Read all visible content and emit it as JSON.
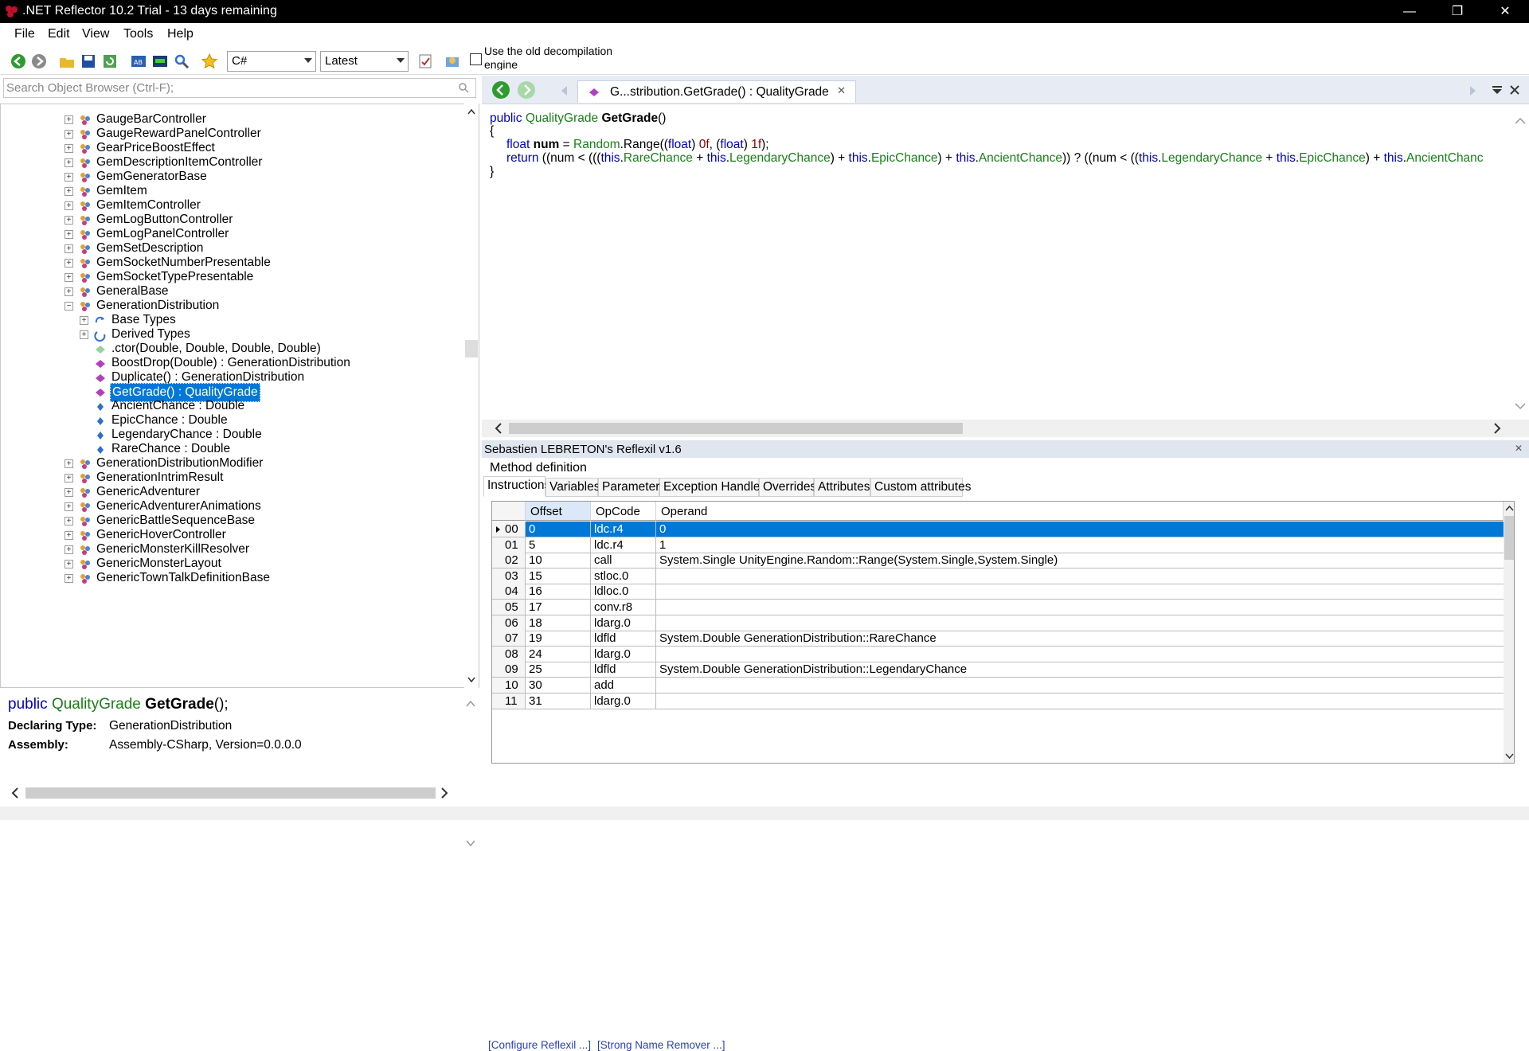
{
  "window": {
    "title": ".NET Reflector 10.2 Trial - 13 days remaining",
    "minimize": "—",
    "maximize": "❐",
    "close": "✕"
  },
  "menu": [
    "File",
    "Edit",
    "View",
    "Tools",
    "Help"
  ],
  "toolbar": {
    "language": "C#",
    "version": "Latest",
    "old_engine_label": "Use the old decompilation engine"
  },
  "search": {
    "placeholder": "Search Object Browser (Ctrl-F);"
  },
  "tree": [
    {
      "label": "GaugeBarController",
      "level": 0,
      "icon": "class"
    },
    {
      "label": "GaugeRewardPanelController",
      "level": 0,
      "icon": "class"
    },
    {
      "label": "GearPriceBoostEffect",
      "level": 0,
      "icon": "class"
    },
    {
      "label": "GemDescriptionItemController",
      "level": 0,
      "icon": "class"
    },
    {
      "label": "GemGeneratorBase",
      "level": 0,
      "icon": "class"
    },
    {
      "label": "GemItem",
      "level": 0,
      "icon": "class"
    },
    {
      "label": "GemItemController",
      "level": 0,
      "icon": "class"
    },
    {
      "label": "GemLogButtonController",
      "level": 0,
      "icon": "class"
    },
    {
      "label": "GemLogPanelController",
      "level": 0,
      "icon": "class"
    },
    {
      "label": "GemSetDescription",
      "level": 0,
      "icon": "class"
    },
    {
      "label": "GemSocketNumberPresentable",
      "level": 0,
      "icon": "class"
    },
    {
      "label": "GemSocketTypePresentable",
      "level": 0,
      "icon": "class"
    },
    {
      "label": "GeneralBase",
      "level": 0,
      "icon": "class"
    },
    {
      "label": "GenerationDistribution",
      "level": 0,
      "icon": "class",
      "expanded": true
    },
    {
      "label": "Base Types",
      "level": 1,
      "icon": "base"
    },
    {
      "label": "Derived Types",
      "level": 1,
      "icon": "derived"
    },
    {
      "label": ".ctor(Double, Double, Double, Double)",
      "level": 1,
      "icon": "ctor",
      "leaf": true
    },
    {
      "label": "BoostDrop(Double) : GenerationDistribution",
      "level": 1,
      "icon": "method",
      "leaf": true
    },
    {
      "label": "Duplicate() : GenerationDistribution",
      "level": 1,
      "icon": "method",
      "leaf": true
    },
    {
      "label": "GetGrade() : QualityGrade",
      "level": 1,
      "icon": "method",
      "leaf": true,
      "selected": true
    },
    {
      "label": "AncientChance : Double",
      "level": 1,
      "icon": "field",
      "leaf": true
    },
    {
      "label": "EpicChance : Double",
      "level": 1,
      "icon": "field",
      "leaf": true
    },
    {
      "label": "LegendaryChance : Double",
      "level": 1,
      "icon": "field",
      "leaf": true
    },
    {
      "label": "RareChance : Double",
      "level": 1,
      "icon": "field",
      "leaf": true
    },
    {
      "label": "GenerationDistributionModifier",
      "level": 0,
      "icon": "class"
    },
    {
      "label": "GenerationIntrimResult",
      "level": 0,
      "icon": "class"
    },
    {
      "label": "GenericAdventurer",
      "level": 0,
      "icon": "class"
    },
    {
      "label": "GenericAdventurerAnimations",
      "level": 0,
      "icon": "class"
    },
    {
      "label": "GenericBattleSequenceBase",
      "level": 0,
      "icon": "class"
    },
    {
      "label": "GenericHoverController",
      "level": 0,
      "icon": "class"
    },
    {
      "label": "GenericMonsterKillResolver",
      "level": 0,
      "icon": "class"
    },
    {
      "label": "GenericMonsterLayout",
      "level": 0,
      "icon": "class"
    },
    {
      "label": "GenericTownTalkDefinitionBase",
      "level": 0,
      "icon": "class"
    }
  ],
  "description": {
    "kw": "public",
    "type": "QualityGrade",
    "name": "GetGrade",
    "suffix": "();",
    "declaring_label": "Declaring Type:",
    "declaring_value": "GenerationDistribution",
    "assembly_label": "Assembly:",
    "assembly_value": "Assembly-CSharp, Version=0.0.0.0"
  },
  "doc_tab": {
    "title": "G...stribution.GetGrade() : QualityGrade",
    "close": "✕"
  },
  "code": {
    "l1_kw": "public",
    "l1_type": "QualityGrade",
    "l1_name": "GetGrade",
    "l1_rest": "()",
    "l2": "{",
    "l3_kw": "float",
    "l3_name": "num",
    "l3_a": " = ",
    "l3_type": "Random",
    "l3_b": ".Range((",
    "l3_kw2": "float",
    "l3_c": ") ",
    "l3_n1": "0f",
    "l3_d": ", (",
    "l3_kw3": "float",
    "l3_e": ") ",
    "l3_n2": "1f",
    "l3_f": ");",
    "l4_kw": "return",
    "l4_a": " ((num < (((",
    "l4_t1": "this",
    "l4_b": ".",
    "l4_f1": "RareChance",
    "l4_c": " + ",
    "l4_t2": "this",
    "l4_d": ".",
    "l4_f2": "LegendaryChance",
    "l4_e": ") + ",
    "l4_t3": "this",
    "l4_g": ".",
    "l4_f3": "EpicChance",
    "l4_h": ") + ",
    "l4_t4": "this",
    "l4_i": ".",
    "l4_f4": "AncientChance",
    "l4_j": ")) ? ((num < ((",
    "l4_t5": "this",
    "l4_k": ".",
    "l4_f5": "LegendaryChance",
    "l4_l": " + ",
    "l4_t6": "this",
    "l4_m": ".",
    "l4_f6": "EpicChance",
    "l4_n": ") + ",
    "l4_t7": "this",
    "l4_o": ".",
    "l4_f7": "AncientChanc",
    "l5": "}"
  },
  "reflexil": {
    "title": "Sebastien LEBRETON's Reflexil v1.6",
    "close": "✕",
    "method_def": "Method definition",
    "tabs": [
      "Instructions",
      "Variables",
      "Parameters",
      "Exception Handlers",
      "Overrides",
      "Attributes",
      "Custom attributes"
    ],
    "columns": [
      "Offset",
      "OpCode",
      "Operand"
    ],
    "rows": [
      {
        "idx": "00",
        "offset": "0",
        "opcode": "ldc.r4",
        "operand": "0",
        "selected": true
      },
      {
        "idx": "01",
        "offset": "5",
        "opcode": "ldc.r4",
        "operand": "1"
      },
      {
        "idx": "02",
        "offset": "10",
        "opcode": "call",
        "operand": "System.Single UnityEngine.Random::Range(System.Single,System.Single)"
      },
      {
        "idx": "03",
        "offset": "15",
        "opcode": "stloc.0",
        "operand": ""
      },
      {
        "idx": "04",
        "offset": "16",
        "opcode": "ldloc.0",
        "operand": ""
      },
      {
        "idx": "05",
        "offset": "17",
        "opcode": "conv.r8",
        "operand": ""
      },
      {
        "idx": "06",
        "offset": "18",
        "opcode": "ldarg.0",
        "operand": ""
      },
      {
        "idx": "07",
        "offset": "19",
        "opcode": "ldfld",
        "operand": "System.Double GenerationDistribution::RareChance"
      },
      {
        "idx": "08",
        "offset": "24",
        "opcode": "ldarg.0",
        "operand": ""
      },
      {
        "idx": "09",
        "offset": "25",
        "opcode": "ldfld",
        "operand": "System.Double GenerationDistribution::LegendaryChance"
      },
      {
        "idx": "10",
        "offset": "30",
        "opcode": "add",
        "operand": ""
      },
      {
        "idx": "11",
        "offset": "31",
        "opcode": "ldarg.0",
        "operand": ""
      }
    ],
    "links": [
      "[Configure Reflexil ...]",
      "[Strong Name Remover ...]"
    ]
  },
  "colors": {
    "accent": "#0078d7",
    "keyword": "#0000c0",
    "type": "#1a7f1a",
    "link": "#2a3fbf"
  }
}
